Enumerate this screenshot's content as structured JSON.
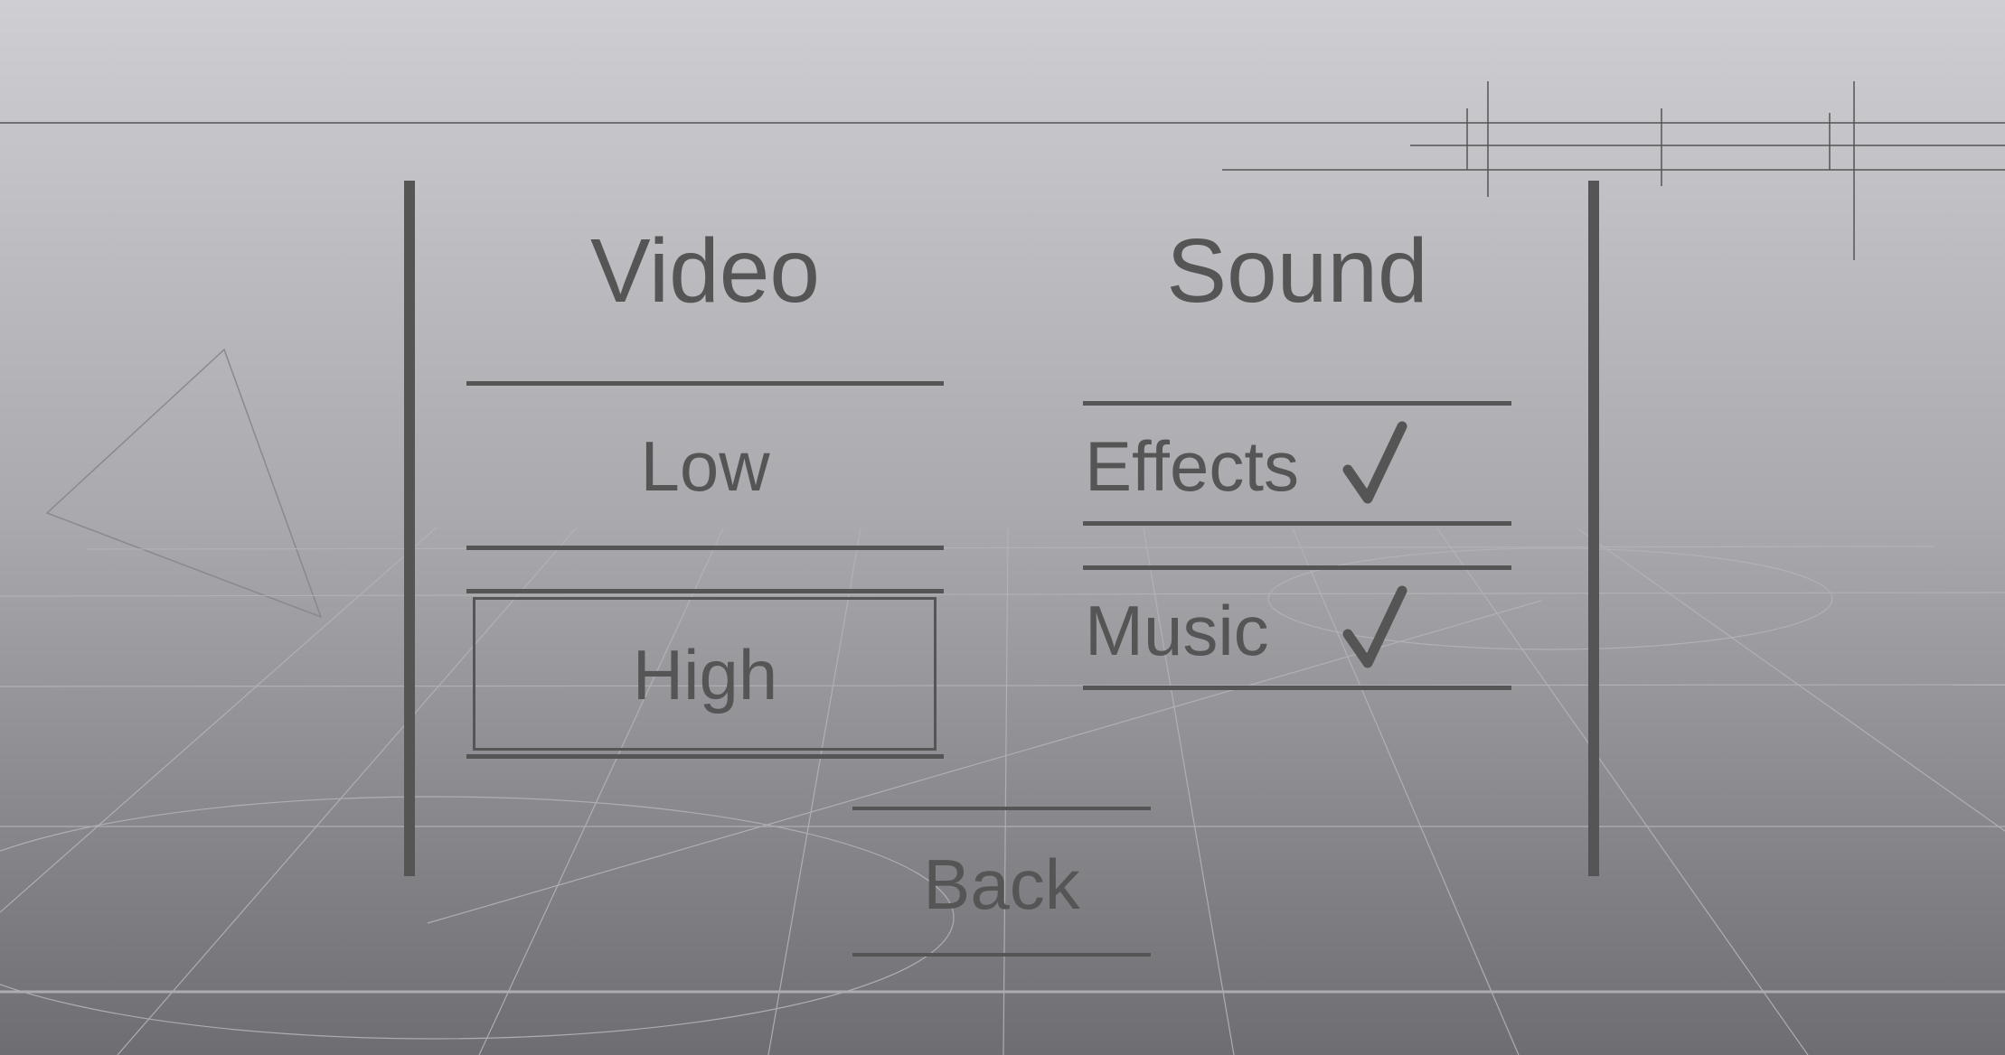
{
  "video": {
    "heading": "Video",
    "options": [
      {
        "label": "Low",
        "selected": false
      },
      {
        "label": "High",
        "selected": true
      }
    ]
  },
  "sound": {
    "heading": "Sound",
    "toggles": [
      {
        "label": "Effects",
        "checked": true,
        "icon": "checkmark-icon"
      },
      {
        "label": "Music",
        "checked": true,
        "icon": "checkmark-icon"
      }
    ]
  },
  "back_label": "Back",
  "colors": {
    "ui": "#555555",
    "bg_top": "#cfced3",
    "bg_bottom": "#6e6d72"
  }
}
